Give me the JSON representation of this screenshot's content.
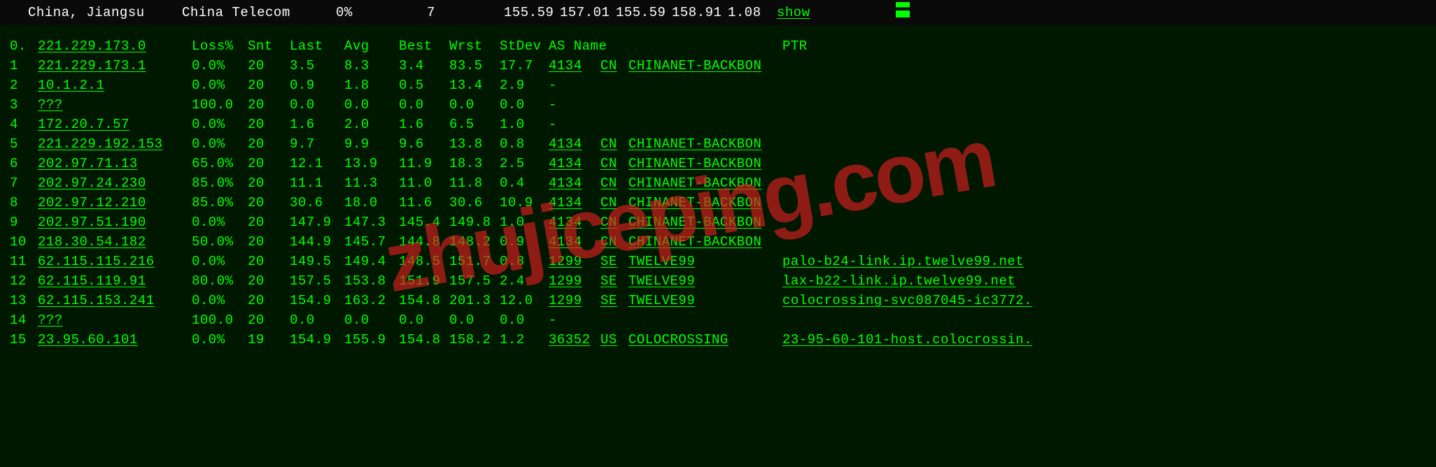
{
  "top_bar": {
    "location": "China, Jiangsu",
    "isp": "China Telecom",
    "loss": "0%",
    "snt": "7",
    "last": "155.59",
    "avg": "157.01",
    "best": "155.59",
    "wrst": "158.91",
    "stdev": "1.08",
    "action": "show"
  },
  "headers": {
    "hop": "0.",
    "ip": "221.229.173.0",
    "loss": "Loss%",
    "snt": "Snt",
    "last": "Last",
    "avg": "Avg",
    "best": "Best",
    "wrst": "Wrst",
    "stdev": "StDev",
    "asname": "AS Name",
    "ptr": "PTR"
  },
  "hops": [
    {
      "n": "1",
      "ip": "221.229.173.1",
      "loss": "0.0%",
      "snt": "20",
      "last": "3.5",
      "avg": "8.3",
      "best": "3.4",
      "wrst": "83.5",
      "stdev": "17.7",
      "as": "4134",
      "cc": "CN",
      "asname": "CHINANET-BACKBON",
      "ptr": ""
    },
    {
      "n": "2",
      "ip": "10.1.2.1",
      "loss": "0.0%",
      "snt": "20",
      "last": "0.9",
      "avg": "1.8",
      "best": "0.5",
      "wrst": "13.4",
      "stdev": "2.9",
      "as": "-",
      "cc": "",
      "asname": "",
      "ptr": ""
    },
    {
      "n": "3",
      "ip": "???",
      "loss": "100.0",
      "snt": "20",
      "last": "0.0",
      "avg": "0.0",
      "best": "0.0",
      "wrst": "0.0",
      "stdev": "0.0",
      "as": "-",
      "cc": "",
      "asname": "",
      "ptr": ""
    },
    {
      "n": "4",
      "ip": "172.20.7.57",
      "loss": "0.0%",
      "snt": "20",
      "last": "1.6",
      "avg": "2.0",
      "best": "1.6",
      "wrst": "6.5",
      "stdev": "1.0",
      "as": "-",
      "cc": "",
      "asname": "",
      "ptr": ""
    },
    {
      "n": "5",
      "ip": "221.229.192.153",
      "loss": "0.0%",
      "snt": "20",
      "last": "9.7",
      "avg": "9.9",
      "best": "9.6",
      "wrst": "13.8",
      "stdev": "0.8",
      "as": "4134",
      "cc": "CN",
      "asname": "CHINANET-BACKBON",
      "ptr": ""
    },
    {
      "n": "6",
      "ip": "202.97.71.13",
      "loss": "65.0%",
      "snt": "20",
      "last": "12.1",
      "avg": "13.9",
      "best": "11.9",
      "wrst": "18.3",
      "stdev": "2.5",
      "as": "4134",
      "cc": "CN",
      "asname": "CHINANET-BACKBON",
      "ptr": ""
    },
    {
      "n": "7",
      "ip": "202.97.24.230",
      "loss": "85.0%",
      "snt": "20",
      "last": "11.1",
      "avg": "11.3",
      "best": "11.0",
      "wrst": "11.8",
      "stdev": "0.4",
      "as": "4134",
      "cc": "CN",
      "asname": "CHINANET-BACKBON",
      "ptr": ""
    },
    {
      "n": "8",
      "ip": "202.97.12.210",
      "loss": "85.0%",
      "snt": "20",
      "last": "30.6",
      "avg": "18.0",
      "best": "11.6",
      "wrst": "30.6",
      "stdev": "10.9",
      "as": "4134",
      "cc": "CN",
      "asname": "CHINANET-BACKBON",
      "ptr": ""
    },
    {
      "n": "9",
      "ip": "202.97.51.190",
      "loss": "0.0%",
      "snt": "20",
      "last": "147.9",
      "avg": "147.3",
      "best": "145.4",
      "wrst": "149.8",
      "stdev": "1.0",
      "as": "4134",
      "cc": "CN",
      "asname": "CHINANET-BACKBON",
      "ptr": ""
    },
    {
      "n": "10",
      "ip": "218.30.54.182",
      "loss": "50.0%",
      "snt": "20",
      "last": "144.9",
      "avg": "145.7",
      "best": "144.8",
      "wrst": "148.2",
      "stdev": "0.9",
      "as": "4134",
      "cc": "CN",
      "asname": "CHINANET-BACKBON",
      "ptr": ""
    },
    {
      "n": "11",
      "ip": "62.115.115.216",
      "loss": "0.0%",
      "snt": "20",
      "last": "149.5",
      "avg": "149.4",
      "best": "148.5",
      "wrst": "151.7",
      "stdev": "0.8",
      "as": "1299",
      "cc": "SE",
      "asname": "TWELVE99",
      "ptr": "palo-b24-link.ip.twelve99.net"
    },
    {
      "n": "12",
      "ip": "62.115.119.91",
      "loss": "80.0%",
      "snt": "20",
      "last": "157.5",
      "avg": "153.8",
      "best": "151.9",
      "wrst": "157.5",
      "stdev": "2.4",
      "as": "1299",
      "cc": "SE",
      "asname": "TWELVE99",
      "ptr": "lax-b22-link.ip.twelve99.net"
    },
    {
      "n": "13",
      "ip": "62.115.153.241",
      "loss": "0.0%",
      "snt": "20",
      "last": "154.9",
      "avg": "163.2",
      "best": "154.8",
      "wrst": "201.3",
      "stdev": "12.0",
      "as": "1299",
      "cc": "SE",
      "asname": "TWELVE99",
      "ptr": "colocrossing-svc087045-ic3772."
    },
    {
      "n": "14",
      "ip": "???",
      "loss": "100.0",
      "snt": "20",
      "last": "0.0",
      "avg": "0.0",
      "best": "0.0",
      "wrst": "0.0",
      "stdev": "0.0",
      "as": "-",
      "cc": "",
      "asname": "",
      "ptr": ""
    },
    {
      "n": "15",
      "ip": "23.95.60.101",
      "loss": "0.0%",
      "snt": "19",
      "last": "154.9",
      "avg": "155.9",
      "best": "154.8",
      "wrst": "158.2",
      "stdev": "1.2",
      "as": "36352",
      "cc": "US",
      "asname": "COLOCROSSING",
      "ptr": "23-95-60-101-host.colocrossin."
    }
  ],
  "watermark": "zhujiceping.com"
}
